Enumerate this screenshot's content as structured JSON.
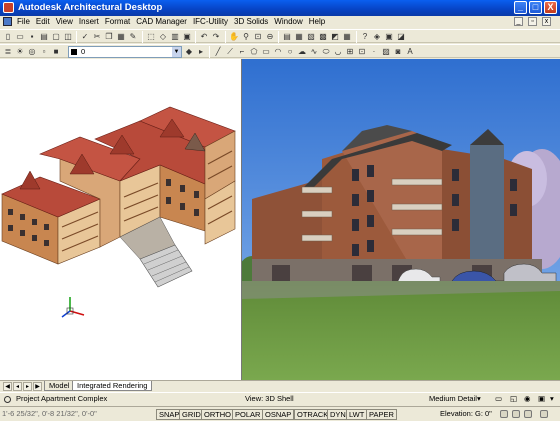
{
  "window": {
    "title": "Autodesk Architectural Desktop",
    "minimize": "_",
    "maximize": "□",
    "close": "X"
  },
  "menu": [
    "File",
    "Edit",
    "View",
    "Insert",
    "Format",
    "CAD Manager",
    "IFC-Utility",
    "3D Solids",
    "Window",
    "Help"
  ],
  "toolbar": {
    "layer_value": "0"
  },
  "viewports": {
    "left_view": "3D model",
    "right_view": "rendering"
  },
  "tabs": {
    "model": "Model",
    "integrated": "Integrated Rendering"
  },
  "status": {
    "project": "Project Apartment Complex",
    "view": "View: 3D Shell",
    "detail": "Medium Detail",
    "coords": "1'-6 25/32\", 0'-8 21/32\", 0'-0\"",
    "modes": [
      "SNAP",
      "GRID",
      "ORTHO",
      "POLAR",
      "OSNAP",
      "OTRACK",
      "DYN",
      "LWT",
      "PAPER"
    ],
    "elevation_label": "Elevation:",
    "elevation_value": "G: 0\""
  },
  "colors": {
    "titlebar": "#0a5ff0",
    "chrome": "#ece9d8",
    "sky": "#3f7fd6",
    "grass": "#6f9a45"
  }
}
